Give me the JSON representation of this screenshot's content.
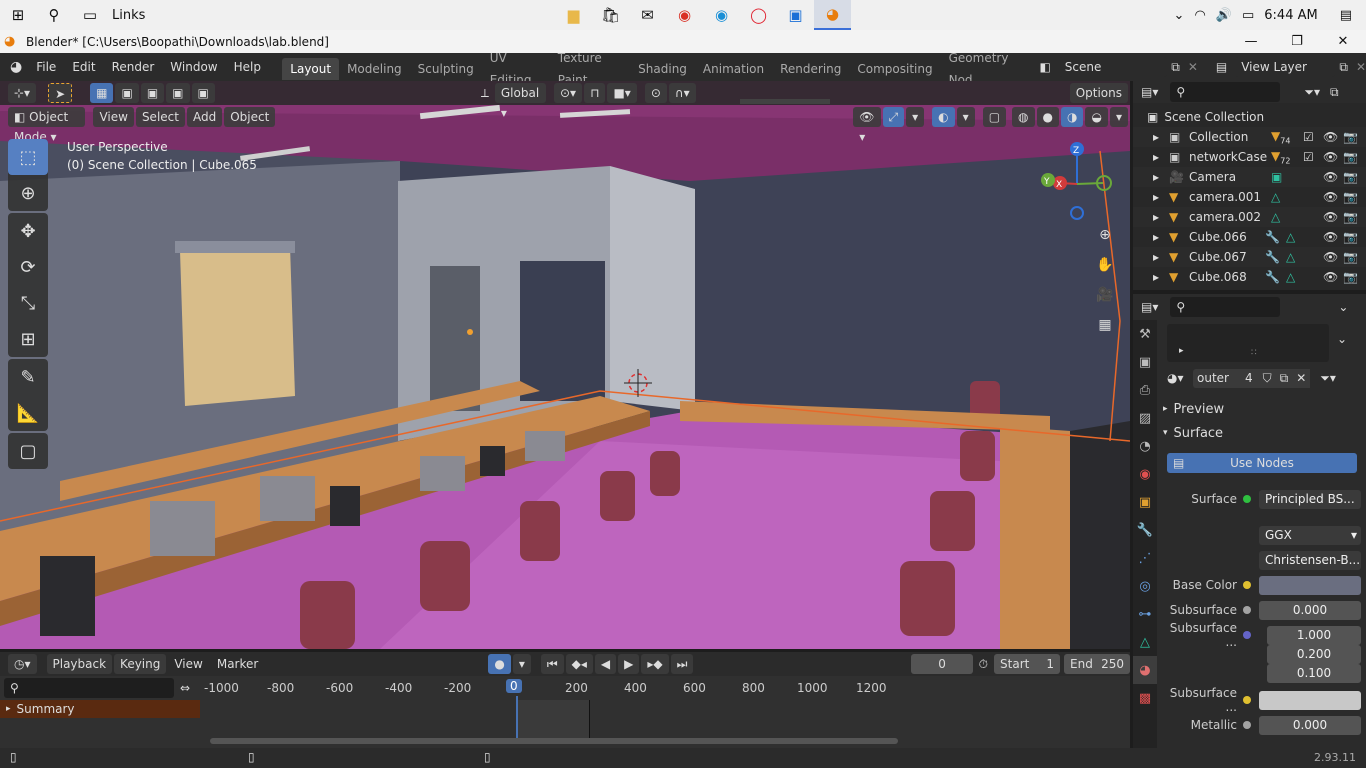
{
  "taskbar": {
    "links_label": "Links",
    "time": "6:44 AM",
    "start_icon": "windows-icon",
    "apps": [
      "file-explorer",
      "store",
      "mail",
      "chrome",
      "edge",
      "opera",
      "app",
      "blender"
    ]
  },
  "window": {
    "title": "Blender* [C:\\Users\\Boopathi\\Downloads\\lab.blend]"
  },
  "topbar": {
    "menus": [
      "File",
      "Edit",
      "Render",
      "Window",
      "Help"
    ],
    "workspaces": [
      "Layout",
      "Modeling",
      "Sculpting",
      "UV Editing",
      "Texture Paint",
      "Shading",
      "Animation",
      "Rendering",
      "Compositing",
      "Geometry Nod"
    ],
    "active_workspace": "Layout",
    "scene": "Scene",
    "view_layer": "View Layer"
  },
  "viewport": {
    "transform": "Global",
    "options": "Options",
    "mode": "Object Mode",
    "menus": [
      "View",
      "Select",
      "Add",
      "Object"
    ],
    "perspective_label": "User Perspective",
    "collection_label": "(0) Scene Collection | Cube.065",
    "gizmo": {
      "x": "X",
      "y": "Y",
      "z": "Z"
    }
  },
  "outliner": {
    "root": "Scene Collection",
    "items": [
      {
        "name": "Collection",
        "badge": "74"
      },
      {
        "name": "networkCase",
        "badge": "72"
      },
      {
        "name": "Camera",
        "badge": ""
      },
      {
        "name": "camera.001",
        "badge": ""
      },
      {
        "name": "camera.002",
        "badge": ""
      },
      {
        "name": "Cube.066",
        "badge": ""
      },
      {
        "name": "Cube.067",
        "badge": ""
      },
      {
        "name": "Cube.068",
        "badge": ""
      }
    ]
  },
  "properties": {
    "material_name": "outer",
    "material_users": "4",
    "preview_label": "Preview",
    "surface_label": "Surface",
    "use_nodes": "Use Nodes",
    "surface_field_label": "Surface",
    "surface_shader": "Principled BS...",
    "distribution": "GGX",
    "subsurface_method": "Christensen-B...",
    "base_color_label": "Base Color",
    "subsurface_label": "Subsurface",
    "subsurface_value": "0.000",
    "subsurface_radius_label": "Subsurface ...",
    "subsurface_radius": [
      "1.000",
      "0.200",
      "0.100"
    ],
    "subsurface_color_label": "Subsurface ...",
    "metallic_label": "Metallic",
    "metallic_value": "0.000",
    "colors": {
      "base_color": "#6a6e80",
      "subsurface_color": "#c8c8c8",
      "use_nodes": "#4772b3"
    }
  },
  "timeline": {
    "menus": [
      "Playback",
      "Keying",
      "View",
      "Marker"
    ],
    "current_frame": "0",
    "start_label": "Start",
    "start": "1",
    "end_label": "End",
    "end": "250",
    "ticks": [
      "-1000",
      "-800",
      "-600",
      "-400",
      "-200",
      "0",
      "200",
      "400",
      "600",
      "800",
      "1000",
      "1200"
    ],
    "summary_label": "Summary"
  },
  "statusbar": {
    "version": "2.93.11"
  }
}
